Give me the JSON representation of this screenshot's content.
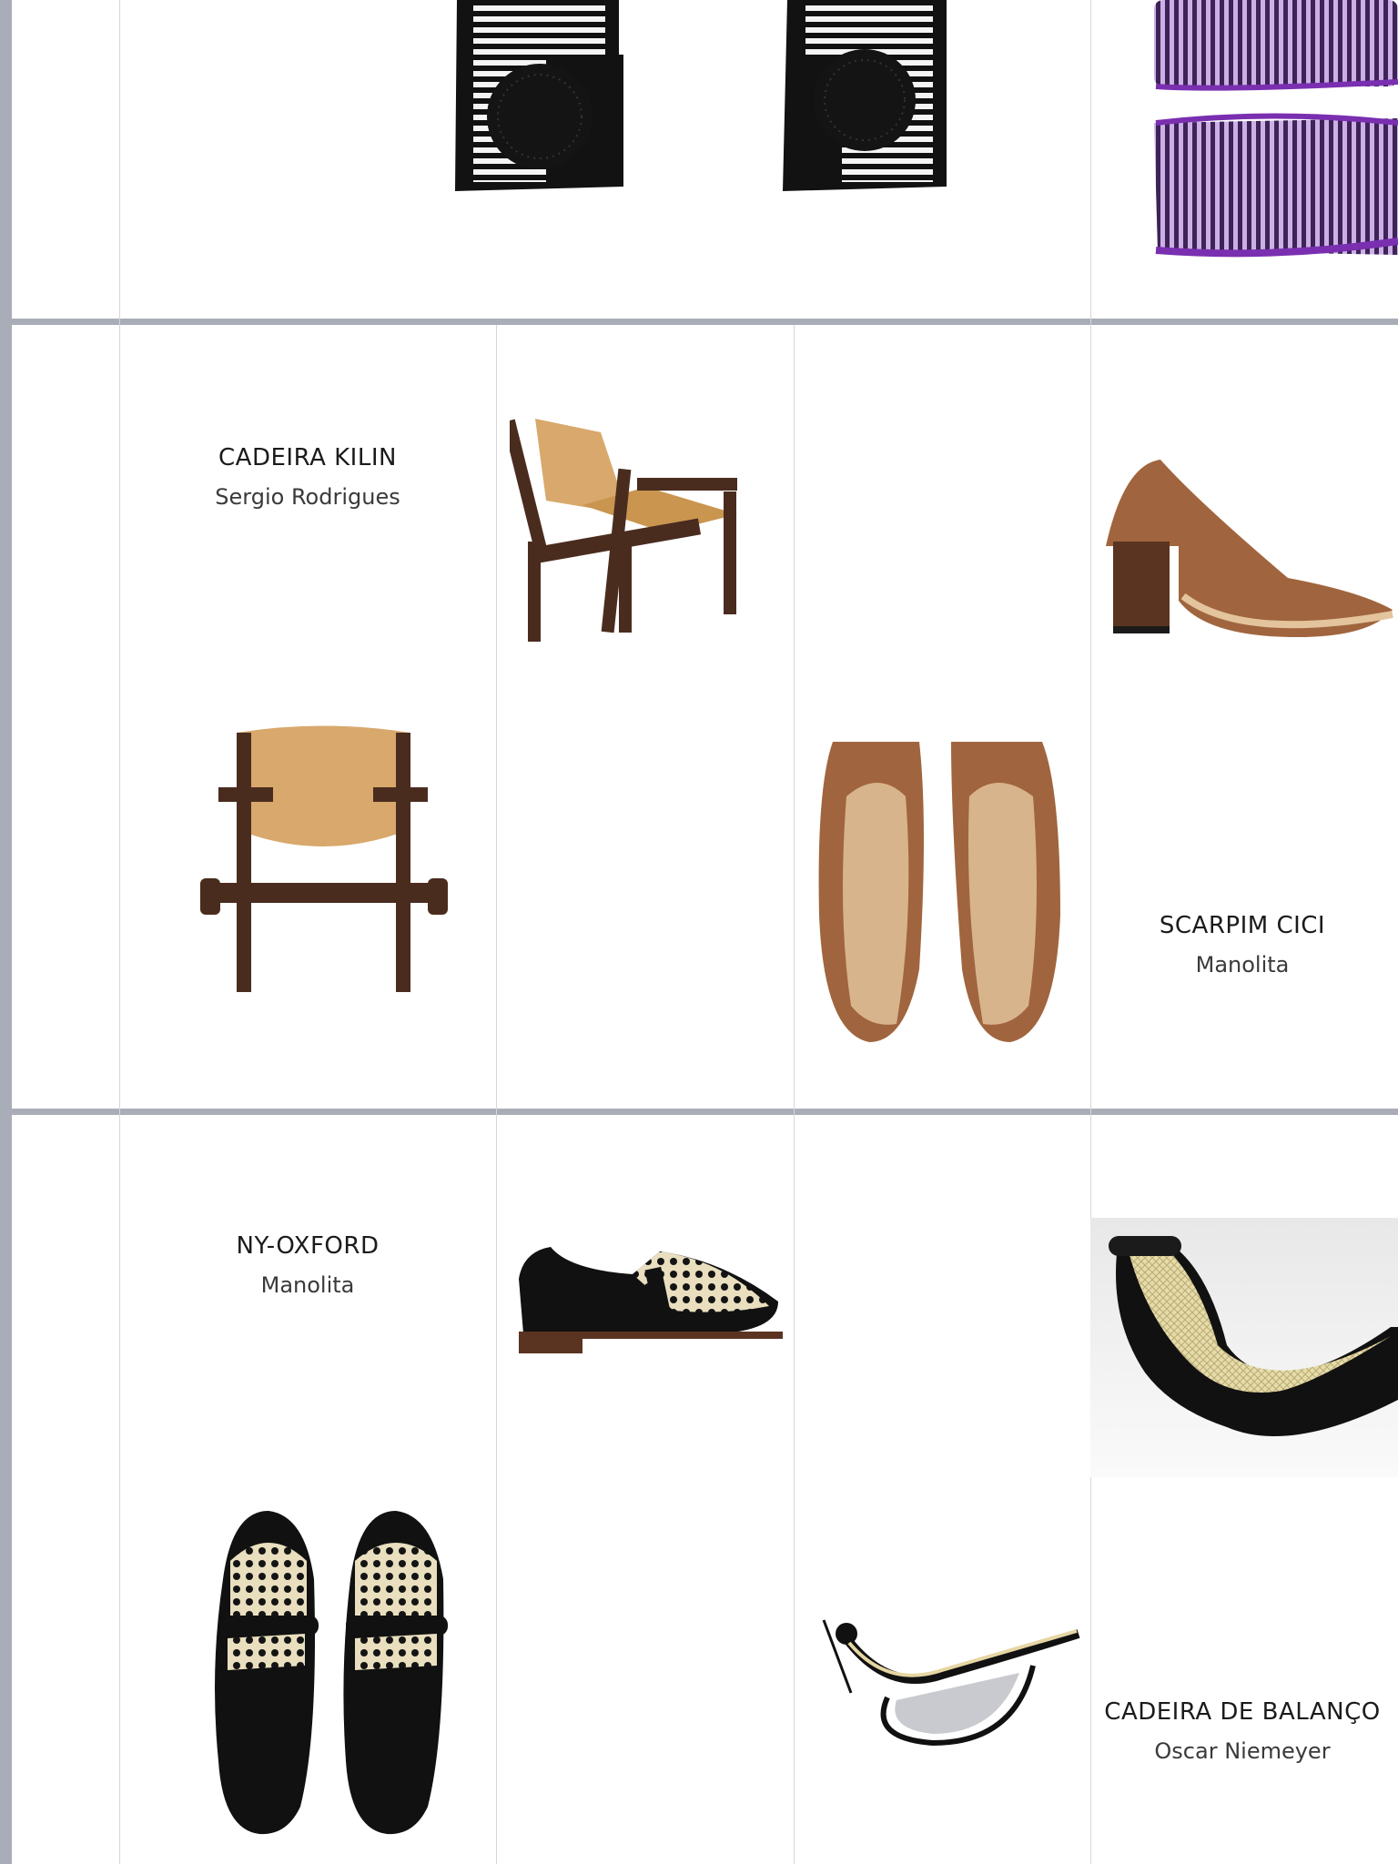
{
  "products": [
    {
      "title": "CADEIRA KILIN",
      "maker": "Sergio Rodrigues"
    },
    {
      "title": "SCARPIM CICI",
      "maker": "Manolita"
    },
    {
      "title": "NY-OXFORD",
      "maker": "Manolita"
    },
    {
      "title": "CADEIRA DE BALANÇO",
      "maker": "Oscar Niemeyer"
    }
  ],
  "colors": {
    "rail": "#a9adb8",
    "divider": "#d6d7db",
    "leather_brown": "#a0653e",
    "walnut": "#4a2c1f",
    "tan_leather": "#d8a86c",
    "black": "#111111",
    "cane": "#e9dfbf",
    "purple": "#7a2fb0"
  }
}
